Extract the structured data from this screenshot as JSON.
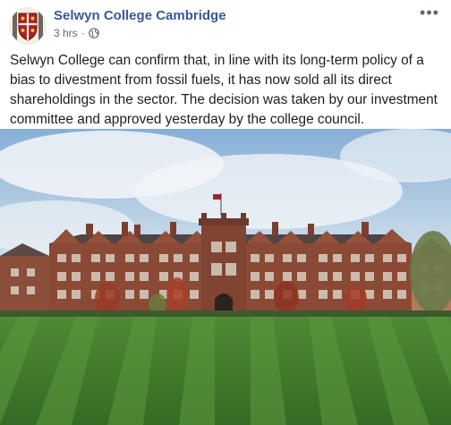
{
  "post": {
    "page_name": "Selwyn College Cambridge",
    "time": "3 hrs",
    "separator": "·",
    "privacy_icon": "globe-icon",
    "more_icon": "ellipsis-icon",
    "more_label": "•••",
    "text": "Selwyn College can confirm that, in line with its long-term policy of a bias to divestment from fossil fuels, it has now sold all its direct shareholdings in the sector. The decision was taken by our investment committee and approved yesterday by the college council.",
    "avatar_icon": "college-crest-icon",
    "photo_icon": "college-building-photo"
  },
  "colors": {
    "link": "#385898",
    "meta": "#606770",
    "text": "#1c1e21",
    "brick": "#8a4a36",
    "lawn": "#3f7a2c"
  }
}
